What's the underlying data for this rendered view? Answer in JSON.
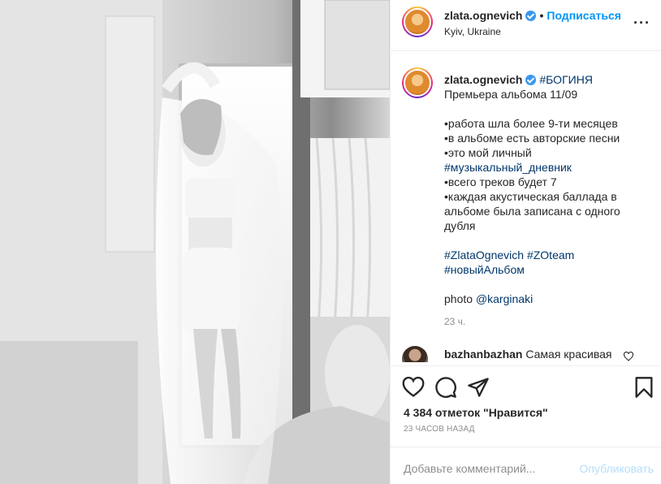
{
  "post": {
    "username": "zlata.ognevich",
    "follow_label": "Подписаться",
    "location": "Kyiv, Ukraine",
    "more_icon": "more-horizontal-icon"
  },
  "caption": {
    "username": "zlata.ognevich",
    "hashtag_first": "#БОГИНЯ",
    "line1": "Премьера альбома 11/09",
    "bullet1": "•работа шла более 9-ти месяцев",
    "bullet2": "•в альбоме есть авторские песни",
    "bullet3": "•это мой личный",
    "bullet3_tag": "#музыкальный_дневник",
    "bullet4": "•всего треков будет 7",
    "bullet5": "•каждая акустическая баллада в альбоме была записана с одного дубля",
    "tag1": "#ZlataOgnevich",
    "tag2": "#ZOteam",
    "tag3": "#новыйАльбом",
    "photo_label": "photo",
    "photo_mention": "@karginaki",
    "time": "23 ч."
  },
  "comment": {
    "username": "bazhanbazhan",
    "text": "Самая красивая"
  },
  "actions": {
    "likes": "4 384 отметок \"Нравится\"",
    "time_ago": "23 ЧАСОВ НАЗАД"
  },
  "add_comment": {
    "placeholder": "Добавьте комментарий...",
    "publish_label": "Опубликовать"
  },
  "colors": {
    "accent": "#0095f6",
    "link": "#00376b",
    "muted": "#8e8e8e"
  }
}
